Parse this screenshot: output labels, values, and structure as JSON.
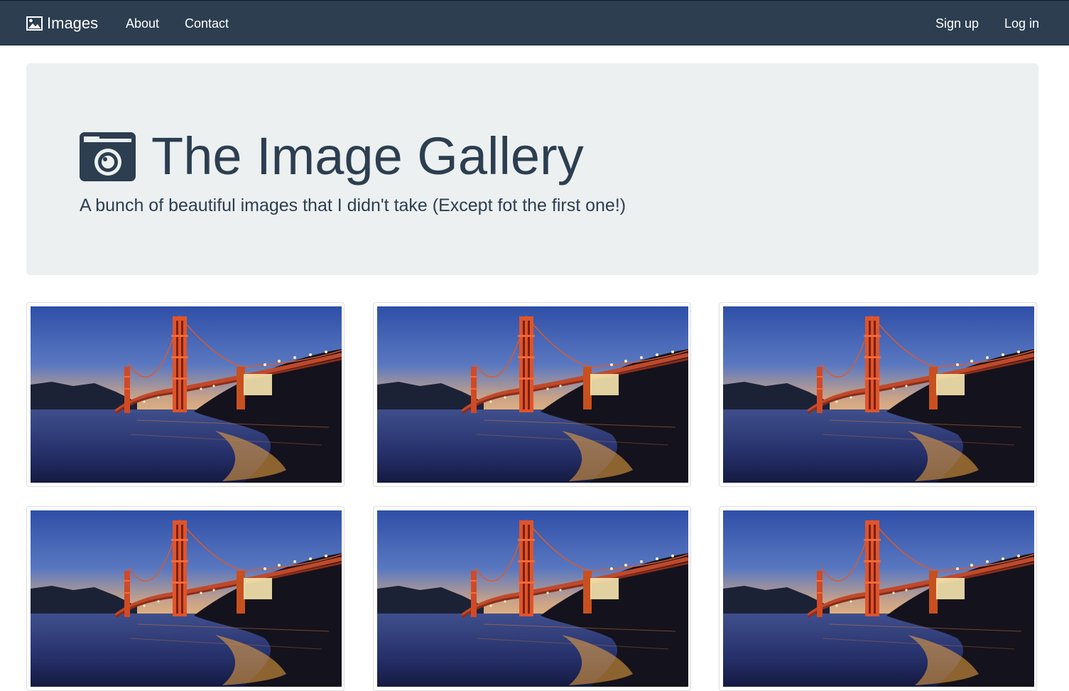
{
  "navbar": {
    "brand_label": "Images",
    "brand_icon": "picture-icon",
    "links": [
      "About",
      "Contact"
    ],
    "right_links": [
      "Sign up",
      "Log in"
    ]
  },
  "jumbotron": {
    "title": "The Image Gallery",
    "title_icon": "camera-icon",
    "subtitle": "A bunch of beautiful images that I didn't take (Except fot the first one!)"
  },
  "gallery": {
    "image_subject": "golden-gate-bridge-at-dusk",
    "rows_visible": 2,
    "columns": 3
  },
  "colors": {
    "navbar_bg": "#2c3e50",
    "jumbotron_bg": "#ecf0f1",
    "text": "#2c3e50"
  }
}
